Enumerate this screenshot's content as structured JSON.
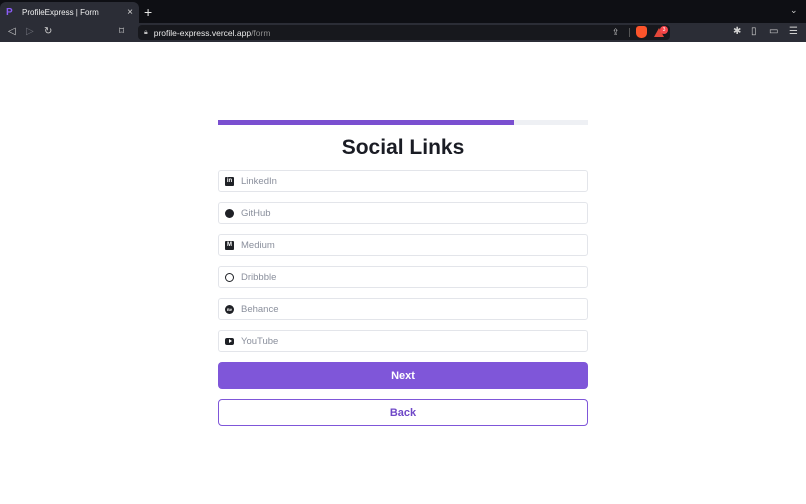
{
  "browser": {
    "tab_title": "ProfileExpress | Form",
    "tab_favicon": "P",
    "tab_close": "×",
    "new_tab": "+",
    "tab_menu": "⌄",
    "url_host": "profile-express.vercel.app",
    "url_path": "/form",
    "rewards_badge": "3",
    "icons": {
      "back": "back-arrow-icon",
      "forward": "forward-arrow-icon",
      "reload": "reload-icon",
      "bookmark": "bookmark-icon",
      "lock": "lock-icon",
      "share": "share-icon",
      "brave": "brave-shield-icon",
      "rewards": "brave-rewards-icon",
      "extensions": "puzzle-icon",
      "sidebar": "sidebar-icon",
      "wallet": "wallet-icon",
      "menu": "hamburger-menu-icon"
    }
  },
  "form": {
    "progress": 0.8,
    "title": "Social Links",
    "fields": [
      {
        "placeholder": "LinkedIn",
        "icon": "linkedin-icon",
        "glyph": "in"
      },
      {
        "placeholder": "GitHub",
        "icon": "github-icon",
        "glyph": ""
      },
      {
        "placeholder": "Medium",
        "icon": "medium-icon",
        "glyph": "M"
      },
      {
        "placeholder": "Dribbble",
        "icon": "dribbble-icon",
        "glyph": ""
      },
      {
        "placeholder": "Behance",
        "icon": "behance-icon",
        "glyph": "Bē"
      },
      {
        "placeholder": "YouTube",
        "icon": "youtube-icon",
        "glyph": ""
      }
    ],
    "next_label": "Next",
    "back_label": "Back"
  },
  "colors": {
    "accent": "#7f56d9",
    "progress_fill": "#7a4fd0",
    "progress_track": "#eef0f4",
    "title": "#1a1c24",
    "browser_chrome": "#2b2d36"
  }
}
